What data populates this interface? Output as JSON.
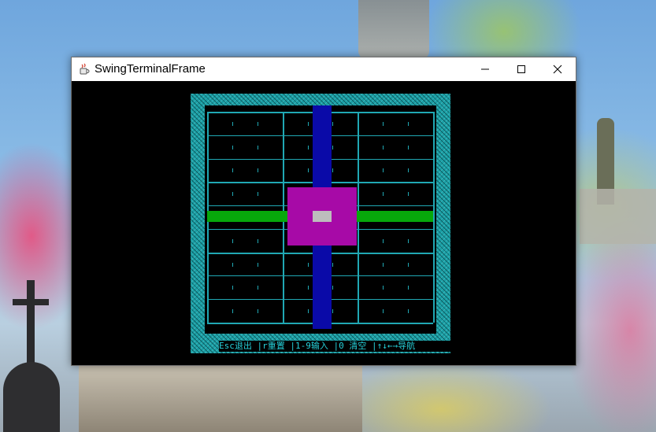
{
  "window": {
    "title": "SwingTerminalFrame",
    "app_icon": "java-cup-icon",
    "controls": {
      "minimize_icon": "minimize-icon",
      "maximize_icon": "maximize-icon",
      "close_icon": "close-icon"
    }
  },
  "terminal": {
    "status_line": "Esc退出 |r重置 |1-9输入 |0 清空 |↑↓←→导航",
    "colors": {
      "border": "#1a9da3",
      "grid": "#20a8b4",
      "row_highlight": "#07a80b",
      "column_highlight": "#0a0aa8",
      "box_highlight": "#a70aa7",
      "cursor": "#bdbdbd",
      "background": "#000000"
    }
  }
}
